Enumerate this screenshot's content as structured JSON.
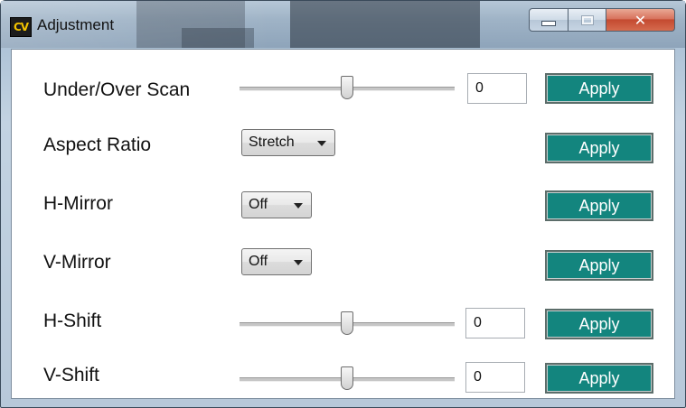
{
  "window": {
    "logo_text": "CV",
    "title": "Adjustment",
    "close_glyph": "✕"
  },
  "rows": {
    "under_over_scan": {
      "label": "Under/Over Scan",
      "value": "0",
      "slider_level": 0.5,
      "apply": "Apply"
    },
    "aspect_ratio": {
      "label": "Aspect Ratio",
      "selected": "Stretch",
      "apply": "Apply"
    },
    "h_mirror": {
      "label": "H-Mirror",
      "selected": "Off",
      "apply": "Apply"
    },
    "v_mirror": {
      "label": "V-Mirror",
      "selected": "Off",
      "apply": "Apply"
    },
    "h_shift": {
      "label": "H-Shift",
      "value": "0",
      "slider_level": 0.5,
      "apply": "Apply"
    },
    "v_shift": {
      "label": "V-Shift",
      "value": "0",
      "slider_level": 0.5,
      "apply": "Apply"
    }
  },
  "colors": {
    "apply_button": "#13857e",
    "logo_text": "#f3c400",
    "close_button": "#c44a30"
  },
  "icons": {
    "minimize": "minimize-icon",
    "maximize": "maximize-icon",
    "close": "close-icon",
    "dropdown": "chevron-down-icon"
  }
}
